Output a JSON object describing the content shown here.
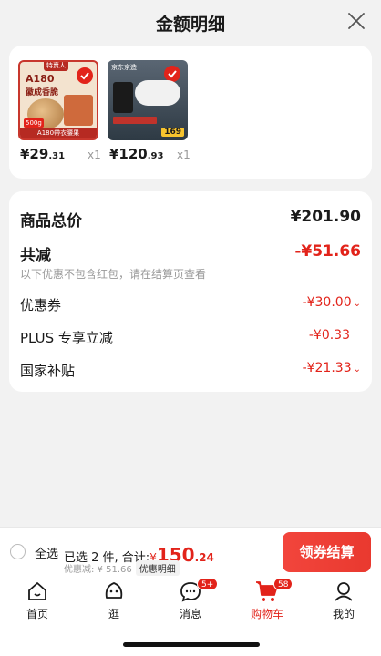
{
  "sheet": {
    "title": "金额明细"
  },
  "products": [
    {
      "price_int": "¥29",
      "price_dec": ".31",
      "qty": "x1",
      "tag": "特賣人",
      "headline": "A180",
      "subline": "徽成香脆",
      "stamp": "500g",
      "ribbon": "A180帶衣腰果"
    },
    {
      "price_int": "¥120",
      "price_dec": ".93",
      "qty": "x1",
      "tag": "京东京造",
      "chip": "169"
    }
  ],
  "summary": {
    "total_label": "商品总价",
    "total_value": "¥201.90",
    "reduce_label": "共减",
    "reduce_value": "-¥51.66",
    "reduce_note": "以下优惠不包含红包，请在结算页查看",
    "coupon_label": "优惠券",
    "coupon_value": "-¥30.00",
    "plus_label": "PLUS 专享立减",
    "plus_value": "-¥0.33",
    "subsidy_label": "国家补贴",
    "subsidy_value": "-¥21.33"
  },
  "bottombar": {
    "select_all": "全选",
    "selected_text": "已选 2 件, 合计:",
    "yen": "¥",
    "total_int": "150",
    "total_dec": ".24",
    "discount_text": "优惠减: ¥ 51.66",
    "detail_tag": "优惠明细",
    "checkout_label": "领券结算"
  },
  "tabs": [
    {
      "label": "首页",
      "icon": "home-icon"
    },
    {
      "label": "逛",
      "icon": "stroll-face-icon"
    },
    {
      "label": "消息",
      "icon": "message-icon",
      "badge": "5+"
    },
    {
      "label": "购物车",
      "icon": "cart-icon",
      "badge": "58",
      "active": true
    },
    {
      "label": "我的",
      "icon": "user-icon"
    }
  ],
  "colors": {
    "accent": "#e2231a",
    "background": "#f2f2f2"
  }
}
